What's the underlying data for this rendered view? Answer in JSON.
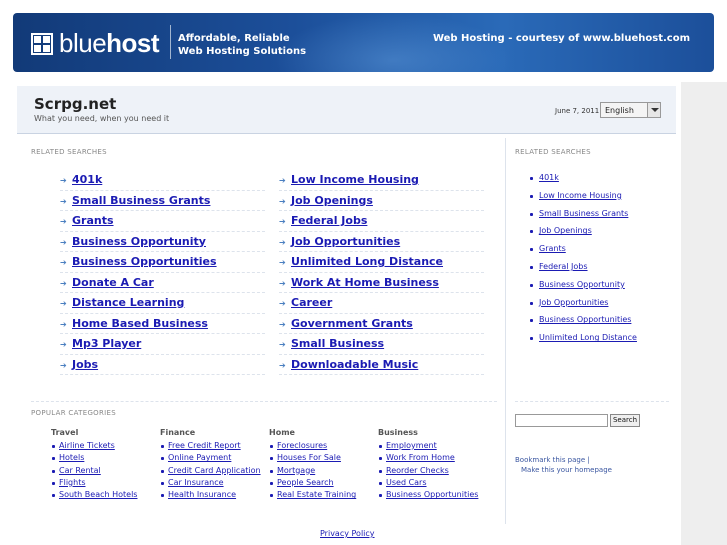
{
  "banner": {
    "logo_light": "blue",
    "logo_bold": "host",
    "tagline_line1": "Affordable, Reliable",
    "tagline_line2": "Web Hosting Solutions",
    "right_text": "Web Hosting - courtesy of www.bluehost.com"
  },
  "header": {
    "site_title": "Scrpg.net",
    "site_subtitle": "What you need, when you need it",
    "date": "June 7, 2011",
    "language_selected": "English"
  },
  "related_label": "RELATED SEARCHES",
  "related_left": [
    "401k",
    "Small Business Grants",
    "Grants",
    "Business Opportunity",
    "Business Opportunities",
    "Donate A Car",
    "Distance Learning",
    "Home Based Business",
    "Mp3 Player",
    "Jobs"
  ],
  "related_right": [
    "Low Income Housing",
    "Job Openings",
    "Federal Jobs",
    "Job Opportunities",
    "Unlimited Long Distance",
    "Work At Home Business",
    "Career",
    "Government Grants",
    "Small Business",
    "Downloadable Music"
  ],
  "sidebar": {
    "label": "RELATED SEARCHES",
    "items": [
      "401k",
      "Low Income Housing",
      "Small Business Grants",
      "Job Openings",
      "Grants",
      "Federal Jobs",
      "Business Opportunity",
      "Job Opportunities",
      "Business Opportunities",
      "Unlimited Long Distance"
    ],
    "search_button": "Search",
    "bookmark_text": "Bookmark this page",
    "homepage_text": "Make this your homepage"
  },
  "popular": {
    "label": "POPULAR CATEGORIES",
    "categories": [
      {
        "title": "Travel",
        "items": [
          "Airline Tickets",
          "Hotels",
          "Car Rental",
          "Flights",
          "South Beach Hotels"
        ]
      },
      {
        "title": "Finance",
        "items": [
          "Free Credit Report",
          "Online Payment",
          "Credit Card Application",
          "Car Insurance",
          "Health Insurance"
        ]
      },
      {
        "title": "Home",
        "items": [
          "Foreclosures",
          "Houses For Sale",
          "Mortgage",
          "People Search",
          "Real Estate Training"
        ]
      },
      {
        "title": "Business",
        "items": [
          "Employment",
          "Work From Home",
          "Reorder Checks",
          "Used Cars",
          "Business Opportunities"
        ]
      }
    ]
  },
  "footer": {
    "privacy": "Privacy Policy"
  },
  "colors": {
    "link": "#1b1bb3",
    "banner": "#1c4f9a",
    "header_bg": "#eef2f8"
  }
}
